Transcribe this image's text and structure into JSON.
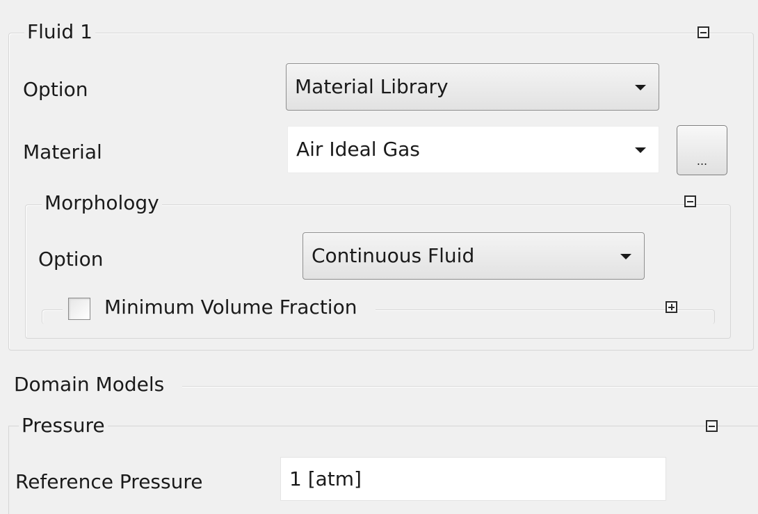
{
  "fluid": {
    "title": "Fluid 1",
    "option_label": "Option",
    "option_value": "Material Library",
    "material_label": "Material",
    "material_value": "Air Ideal Gas",
    "browse_label": "...",
    "morphology": {
      "title": "Morphology",
      "option_label": "Option",
      "option_value": "Continuous Fluid",
      "min_volume_label": "Minimum Volume Fraction",
      "min_volume_checked": false
    }
  },
  "domain_models": {
    "title": "Domain Models",
    "pressure": {
      "title": "Pressure",
      "reference_label": "Reference Pressure",
      "reference_value": "1 [atm]"
    }
  }
}
